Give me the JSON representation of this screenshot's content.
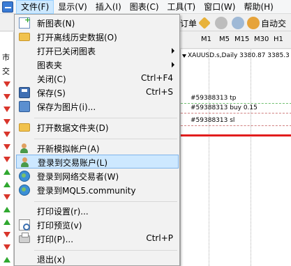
{
  "menubar": {
    "items": [
      "文件(F)",
      "显示(V)",
      "插入(I)",
      "图表(C)",
      "工具(T)",
      "窗口(W)",
      "帮助(H)"
    ]
  },
  "toolbar": {
    "order_fragment": "订单",
    "autotrade_fragment": "自动交"
  },
  "timeframes": [
    "M1",
    "M5",
    "M15",
    "M30",
    "H1"
  ],
  "left_strip": {
    "label_top": "市",
    "label_second": "交"
  },
  "chart": {
    "symbol_line": "XAUUSD.s,Daily  3380.87 3385.3",
    "annotations": [
      "#59388313 tp",
      "#59388313 buy 0.15",
      "#59388313 sl"
    ]
  },
  "file_menu": {
    "items": [
      {
        "label": "新图表(N)",
        "shortcut": "",
        "icon": "new-chart-icon"
      },
      {
        "label": "打开离线历史数据(O)",
        "shortcut": "",
        "icon": "open-folder-icon"
      },
      {
        "label": "打开已关闭图表",
        "shortcut": "",
        "icon": ""
      },
      {
        "label": "图表夹",
        "shortcut": "",
        "icon": ""
      },
      {
        "label": "关闭(C)",
        "shortcut": "Ctrl+F4",
        "icon": ""
      },
      {
        "label": "保存(S)",
        "shortcut": "Ctrl+S",
        "icon": "save-icon"
      },
      {
        "label": "保存为图片(i)...",
        "shortcut": "",
        "icon": "save-image-icon"
      },
      {
        "label": "打开数据文件夹(D)",
        "shortcut": "",
        "icon": "data-folder-icon"
      },
      {
        "label": "开新模拟帐户(A)",
        "shortcut": "",
        "icon": "demo-account-icon"
      },
      {
        "label": "登录到交易账户(L)",
        "shortcut": "",
        "icon": "login-icon"
      },
      {
        "label": "登录到网络交易者(W)",
        "shortcut": "",
        "icon": "web-trader-icon"
      },
      {
        "label": "登录到MQL5.community",
        "shortcut": "",
        "icon": "mql5-icon"
      },
      {
        "label": "打印设置(r)...",
        "shortcut": "",
        "icon": ""
      },
      {
        "label": "打印预览(v)",
        "shortcut": "",
        "icon": "print-preview-icon"
      },
      {
        "label": "打印(P)...",
        "shortcut": "Ctrl+P",
        "icon": "print-icon"
      },
      {
        "label": "退出(x)",
        "shortcut": "",
        "icon": ""
      }
    ]
  }
}
